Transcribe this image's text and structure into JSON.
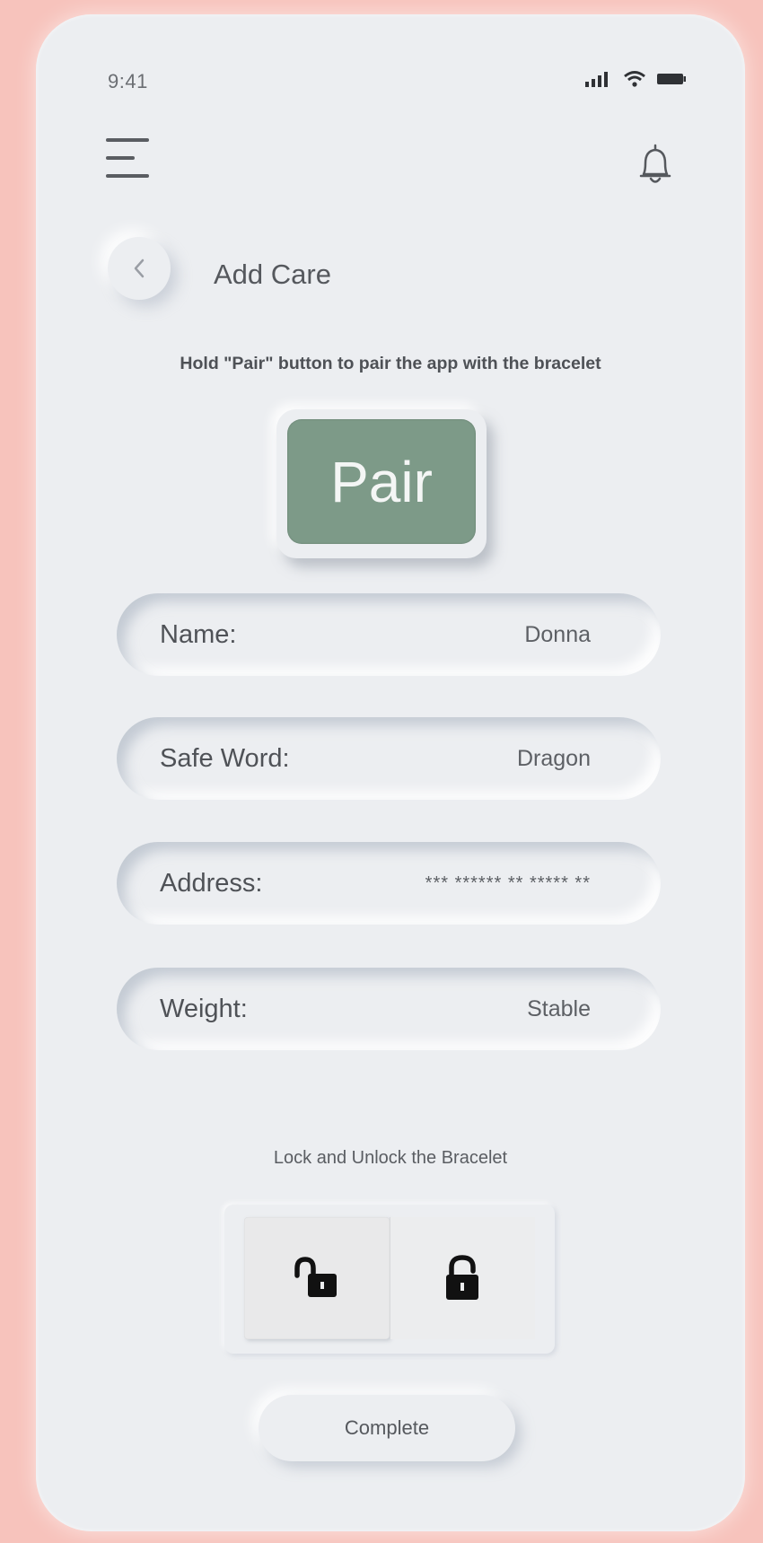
{
  "status_bar": {
    "time": "9:41"
  },
  "header": {
    "title": "Add Care"
  },
  "instruction": "Hold \"Pair\" button to pair the app with the bracelet",
  "pair_button": {
    "label": "Pair",
    "color": "#7d9a88"
  },
  "fields": [
    {
      "label": "Name:",
      "value": "Donna"
    },
    {
      "label": "Safe Word:",
      "value": "Dragon"
    },
    {
      "label": "Address:",
      "value": "*** ****** ** ***** **"
    },
    {
      "label": "Weight:",
      "value": "Stable"
    }
  ],
  "lock_section": {
    "caption": "Lock and Unlock the Bracelet",
    "buttons": [
      {
        "icon": "unlock-icon",
        "selected": true
      },
      {
        "icon": "lock-icon",
        "selected": false
      }
    ]
  },
  "complete_button": {
    "label": "Complete"
  },
  "colors": {
    "background": "#f7c3bc",
    "surface": "#eceef1",
    "accent": "#7d9a88"
  }
}
